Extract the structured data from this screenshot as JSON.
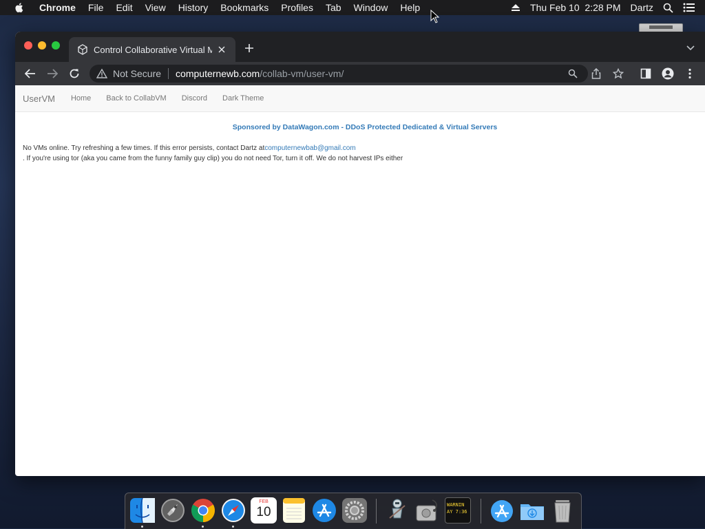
{
  "menubar": {
    "app_name": "Chrome",
    "menus": [
      "File",
      "Edit",
      "View",
      "History",
      "Bookmarks",
      "Profiles",
      "Tab",
      "Window",
      "Help"
    ],
    "datetime": "Thu Feb 10  2:28 PM",
    "user": "Dartz",
    "icons": [
      "apple-icon",
      "eject-icon",
      "search-icon",
      "control-center-icon"
    ]
  },
  "browser": {
    "tab_title": "Control Collaborative Virtual M",
    "security_label": "Not Secure",
    "url_host": "computernewb.com",
    "url_path": "/collab-vm/user-vm/",
    "accent_color": "#337ab7"
  },
  "page": {
    "brand": "UserVM",
    "nav_links": [
      "Home",
      "Back to CollabVM",
      "Discord",
      "Dark Theme"
    ],
    "sponsor": "Sponsored by DataWagon.com - DDoS Protected Dedicated & Virtual Servers",
    "message_line1_prefix": "No VMs online. Try refreshing a few times. If this error persists, contact Dartz at",
    "contact_email": "computernewbab@gmail.com",
    "message_line2": ". If you're using tor (aka you came from the funny family guy clip) you do not need Tor, turn it off. We do not harvest IPs either"
  },
  "dock": {
    "items": [
      "Finder",
      "Launchpad",
      "Google Chrome",
      "Safari",
      "Calendar",
      "Notes",
      "App Store",
      "System Preferences",
      "Automator",
      "Disk Utility",
      "Console",
      "App Store Downloads",
      "Downloads Folder",
      "Trash"
    ],
    "calendar_month": "FEB",
    "calendar_day": "10",
    "console_text": "WARNIN\nAY 7:36"
  }
}
